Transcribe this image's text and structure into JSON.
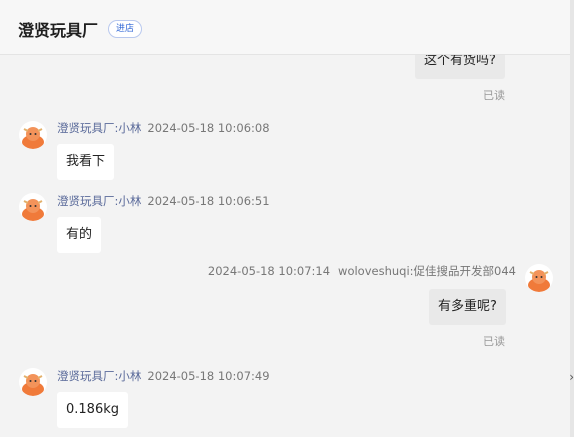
{
  "header": {
    "title": "澄贤玩具厂",
    "enter_label": "进店"
  },
  "messages": [
    {
      "side": "right",
      "text": "这个有货吗?",
      "status": "已读"
    },
    {
      "side": "left",
      "sender": "澄贤玩具厂:小林",
      "time": "2024-05-18 10:06:08",
      "text": "我看下"
    },
    {
      "side": "left",
      "sender": "澄贤玩具厂:小林",
      "time": "2024-05-18 10:06:51",
      "text": "有的"
    },
    {
      "side": "right",
      "sender": "woloveshuqi:促佳搜品开发部044",
      "time": "2024-05-18 10:07:14",
      "text": "有多重呢?",
      "status": "已读"
    },
    {
      "side": "left",
      "sender": "澄贤玩具厂:小林",
      "time": "2024-05-18 10:07:49",
      "text": "0.186kg"
    }
  ],
  "colors": {
    "accent_blue": "#2f66d6",
    "avatar_orange": "#f07a3a"
  },
  "icons": {
    "avatar": "cow-mascot-icon",
    "side_toggle": "chevron-right-icon"
  }
}
